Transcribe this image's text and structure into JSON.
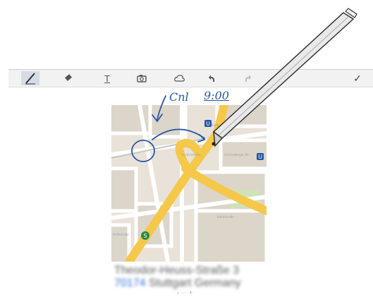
{
  "toolbar": {
    "tools": [
      {
        "name": "pen-tool",
        "icon": "pen-icon"
      },
      {
        "name": "eraser-tool",
        "icon": "eraser-icon"
      },
      {
        "name": "text-tool",
        "icon": "text-icon",
        "label": "T"
      },
      {
        "name": "camera-tool",
        "icon": "camera-icon"
      },
      {
        "name": "shape-tool",
        "icon": "cloud-icon"
      },
      {
        "name": "undo-tool",
        "icon": "undo-icon"
      },
      {
        "name": "redo-tool",
        "icon": "redo-icon"
      },
      {
        "name": "confirm-tool",
        "icon": "check-icon",
        "label": "✓"
      }
    ]
  },
  "map": {
    "station_u": "U",
    "station_s": "S",
    "labels": [
      "Budapester Str.",
      "Kurfürstenstr.",
      "Schöneberger Str.",
      "Keithstraße",
      "Kleiststraße"
    ]
  },
  "annotation": {
    "text_left": "Cnl",
    "time": "9:00"
  },
  "address": {
    "street": "Theodor-Heuss-Straße 3",
    "zip": "70174",
    "city_country": "Stuttgart Germany"
  },
  "page_indicator": "‹ ··· +",
  "colors": {
    "ink": "#2b58a8",
    "road_major": "#f5c84a",
    "road_minor": "#ffffff",
    "block": "#e7e1d8",
    "park": "#cfe3b9"
  }
}
